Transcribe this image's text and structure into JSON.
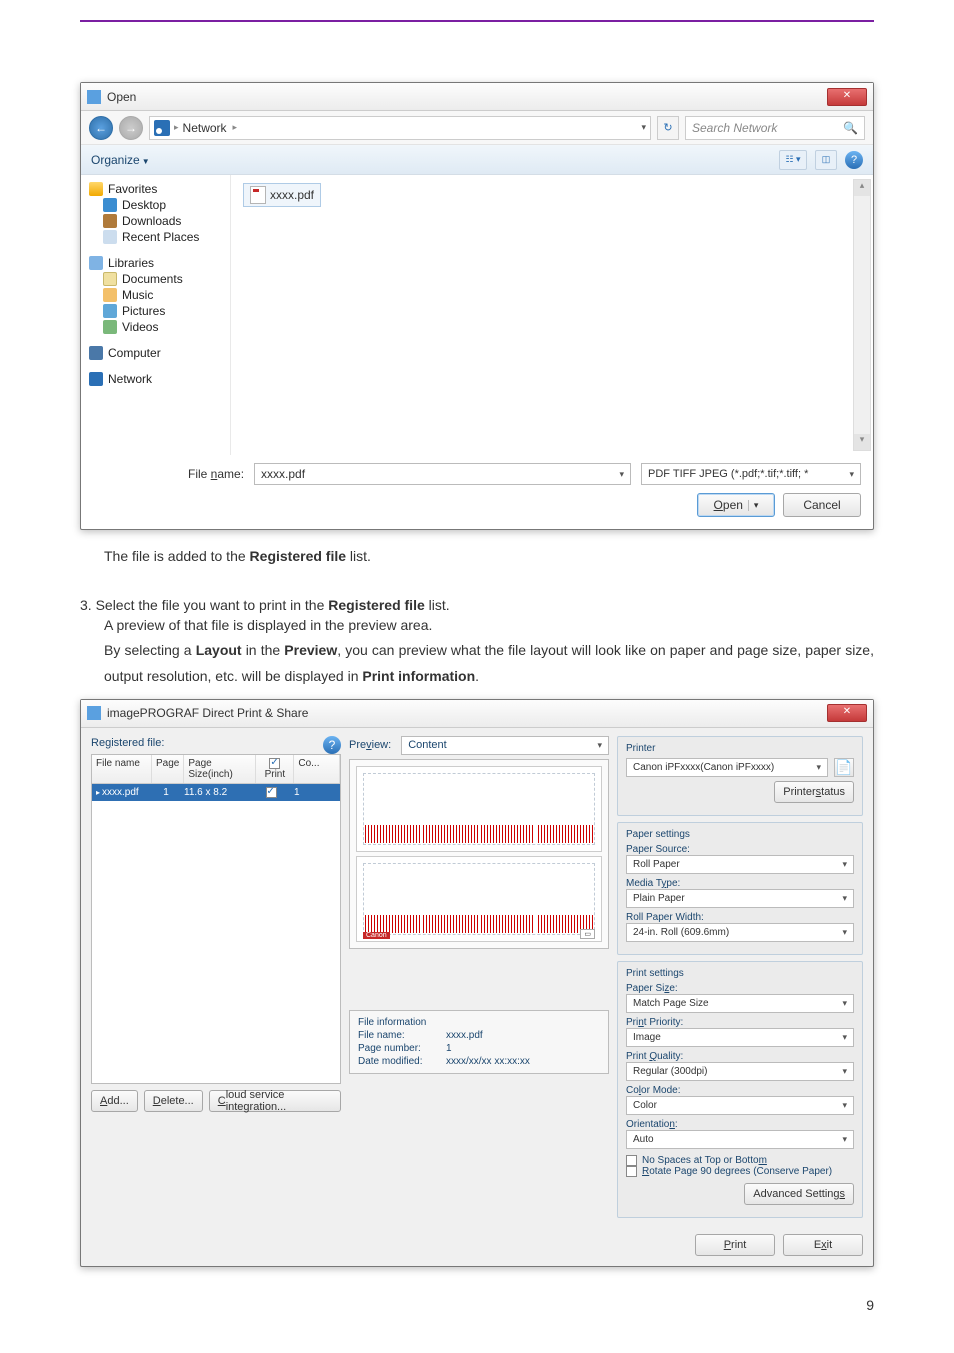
{
  "open_dialog": {
    "title": "Open",
    "breadcrumb_label": "Network",
    "breadcrumb_arrow": "▶",
    "search_placeholder": "Search Network",
    "organize_label": "Organize",
    "nav": {
      "favorites": "Favorites",
      "desktop": "Desktop",
      "downloads": "Downloads",
      "recent_places": "Recent Places",
      "libraries": "Libraries",
      "documents": "Documents",
      "music": "Music",
      "pictures": "Pictures",
      "videos": "Videos",
      "computer": "Computer",
      "network": "Network"
    },
    "file_list": {
      "item0": "xxxx.pdf"
    },
    "file_name_label_pre": "File ",
    "file_name_label_u": "n",
    "file_name_label_post": "ame:",
    "file_name_value": "xxxx.pdf",
    "file_type": "PDF TIFF JPEG (*.pdf;*.tif;*.tiff; *",
    "open_btn_u": "O",
    "open_btn_post": "pen",
    "cancel_btn": "Cancel"
  },
  "text": {
    "after_open": "The file is added to the Registered file list.",
    "registered_file": "Registered file",
    "step3_pre": "3. Select the file you want to print in the ",
    "step3_post": " list.",
    "preview_line": "A preview of that file is displayed in the preview area.",
    "layout_line_pre": "By selecting a ",
    "layout": "Layout",
    "layout_line_mid": " in the ",
    "preview_b": "Preview",
    "layout_line_post1": ", you can preview what the file layout will look like on paper and page size, paper size, output resolution, etc. will be displayed in ",
    "print_info": "Print information",
    "period": "."
  },
  "dps": {
    "title": "imagePROGRAF Direct Print & Share",
    "registered_file_pre": "Re",
    "registered_file_u": "g",
    "registered_file_post": "istered file:",
    "headers": {
      "file_name": "File name",
      "page": "Page",
      "page_size": "Page Size(inch)",
      "print": "Print",
      "co": "Co..."
    },
    "row0": {
      "file_name": "xxxx.pdf",
      "page": "1",
      "page_size": "11.6 x 8.2",
      "co": "1"
    },
    "add_u": "A",
    "add_post": "dd...",
    "delete_u": "D",
    "delete_post": "elete...",
    "cloud_u": "C",
    "cloud_post": "loud service integration...",
    "preview_label_pre": "Pre",
    "preview_label_u": "v",
    "preview_label_post": "iew:",
    "preview_select": "Content",
    "file_info": {
      "title": "File information",
      "fn_lbl": "File name:",
      "fn_val": "xxxx.pdf",
      "pn_lbl": "Page number:",
      "pn_val": "1",
      "dm_lbl": "Date modified:",
      "dm_val": "xxxx/xx/xx xx:xx:xx"
    },
    "printer": {
      "group": "Printer",
      "name": "Canon iPFxxxx(Canon iPFxxxx)",
      "status_u": "s",
      "status_pre": "Printer ",
      "status_post": "tatus"
    },
    "paper": {
      "group": "Paper settings",
      "source_lbl": "Paper Source:",
      "source_val": "Roll Paper",
      "type_lbl_pre": "Media T",
      "type_lbl_u": "y",
      "type_lbl_post": "pe:",
      "type_val": "Plain Paper",
      "width_lbl": "Roll Paper Width:",
      "width_val": "24-in. Roll (609.6mm)"
    },
    "print": {
      "group": "Print settings",
      "size_lbl_pre": "Paper Si",
      "size_lbl_u": "z",
      "size_lbl_post": "e:",
      "size_val": "Match Page Size",
      "prio_lbl_pre": "Pri",
      "prio_lbl_u": "n",
      "prio_lbl_post": "t Priority:",
      "prio_val": "Image",
      "qual_lbl_pre": "Print ",
      "qual_lbl_u": "Q",
      "qual_lbl_post": "uality:",
      "qual_val": "Regular (300dpi)",
      "cmode_lbl_pre": "Co",
      "cmode_lbl_u": "l",
      "cmode_lbl_post": "or Mode:",
      "cmode_val": "Color",
      "orient_lbl_pre": "Orientatio",
      "orient_lbl_u": "n",
      "orient_lbl_post": ":",
      "orient_val": "Auto",
      "nospace_pre": "No Spaces at Top or Botto",
      "nospace_u": "m",
      "rotate_u": "R",
      "rotate_post": "otate Page 90 degrees (Conserve Paper)",
      "adv_pre": "Advanced Setting",
      "adv_u": "s"
    },
    "print_btn_u": "P",
    "print_btn_post": "rint",
    "exit_btn_pre": "E",
    "exit_btn_u": "x",
    "exit_btn_post": "it"
  },
  "page_number": "9"
}
